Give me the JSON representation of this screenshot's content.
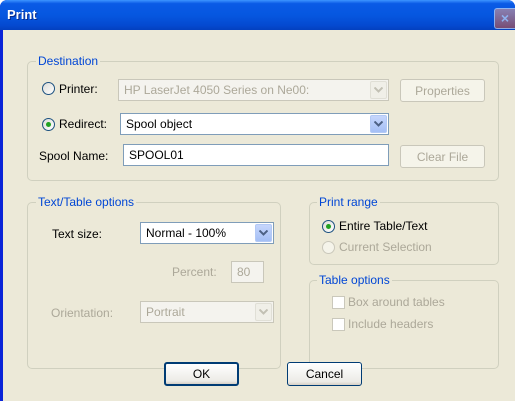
{
  "window": {
    "title": "Print",
    "close_glyph": "×"
  },
  "destination": {
    "group_label": "Destination",
    "printer": {
      "label": "Printer:",
      "selected": false,
      "value": "HP LaserJet 4050 Series on Ne00:",
      "properties_label": "Properties"
    },
    "redirect": {
      "label": "Redirect:",
      "selected": true,
      "value": "Spool object"
    },
    "spool_name": {
      "label": "Spool Name:",
      "value": "SPOOL01",
      "clear_label": "Clear File"
    }
  },
  "text_table_options": {
    "group_label": "Text/Table options",
    "text_size": {
      "label": "Text size:",
      "value": "Normal - 100%"
    },
    "percent": {
      "label": "Percent:",
      "value": "80"
    },
    "orientation": {
      "label": "Orientation:",
      "value": "Portrait"
    }
  },
  "print_range": {
    "group_label": "Print range",
    "options": [
      {
        "label": "Entire Table/Text",
        "selected": true,
        "enabled": true
      },
      {
        "label": "Current Selection",
        "selected": false,
        "enabled": false
      }
    ]
  },
  "table_options": {
    "group_label": "Table options",
    "options": [
      {
        "label": "Box around tables",
        "checked": false,
        "enabled": false
      },
      {
        "label": "Include headers",
        "checked": false,
        "enabled": false
      }
    ]
  },
  "buttons": {
    "ok": "OK",
    "cancel": "Cancel"
  },
  "colors": {
    "titlebar": "#0657e0",
    "dialog_bg": "#ece9d8",
    "group_label": "#0046d5",
    "disabled_text": "#aca899",
    "radio_dot": "#21a121"
  }
}
